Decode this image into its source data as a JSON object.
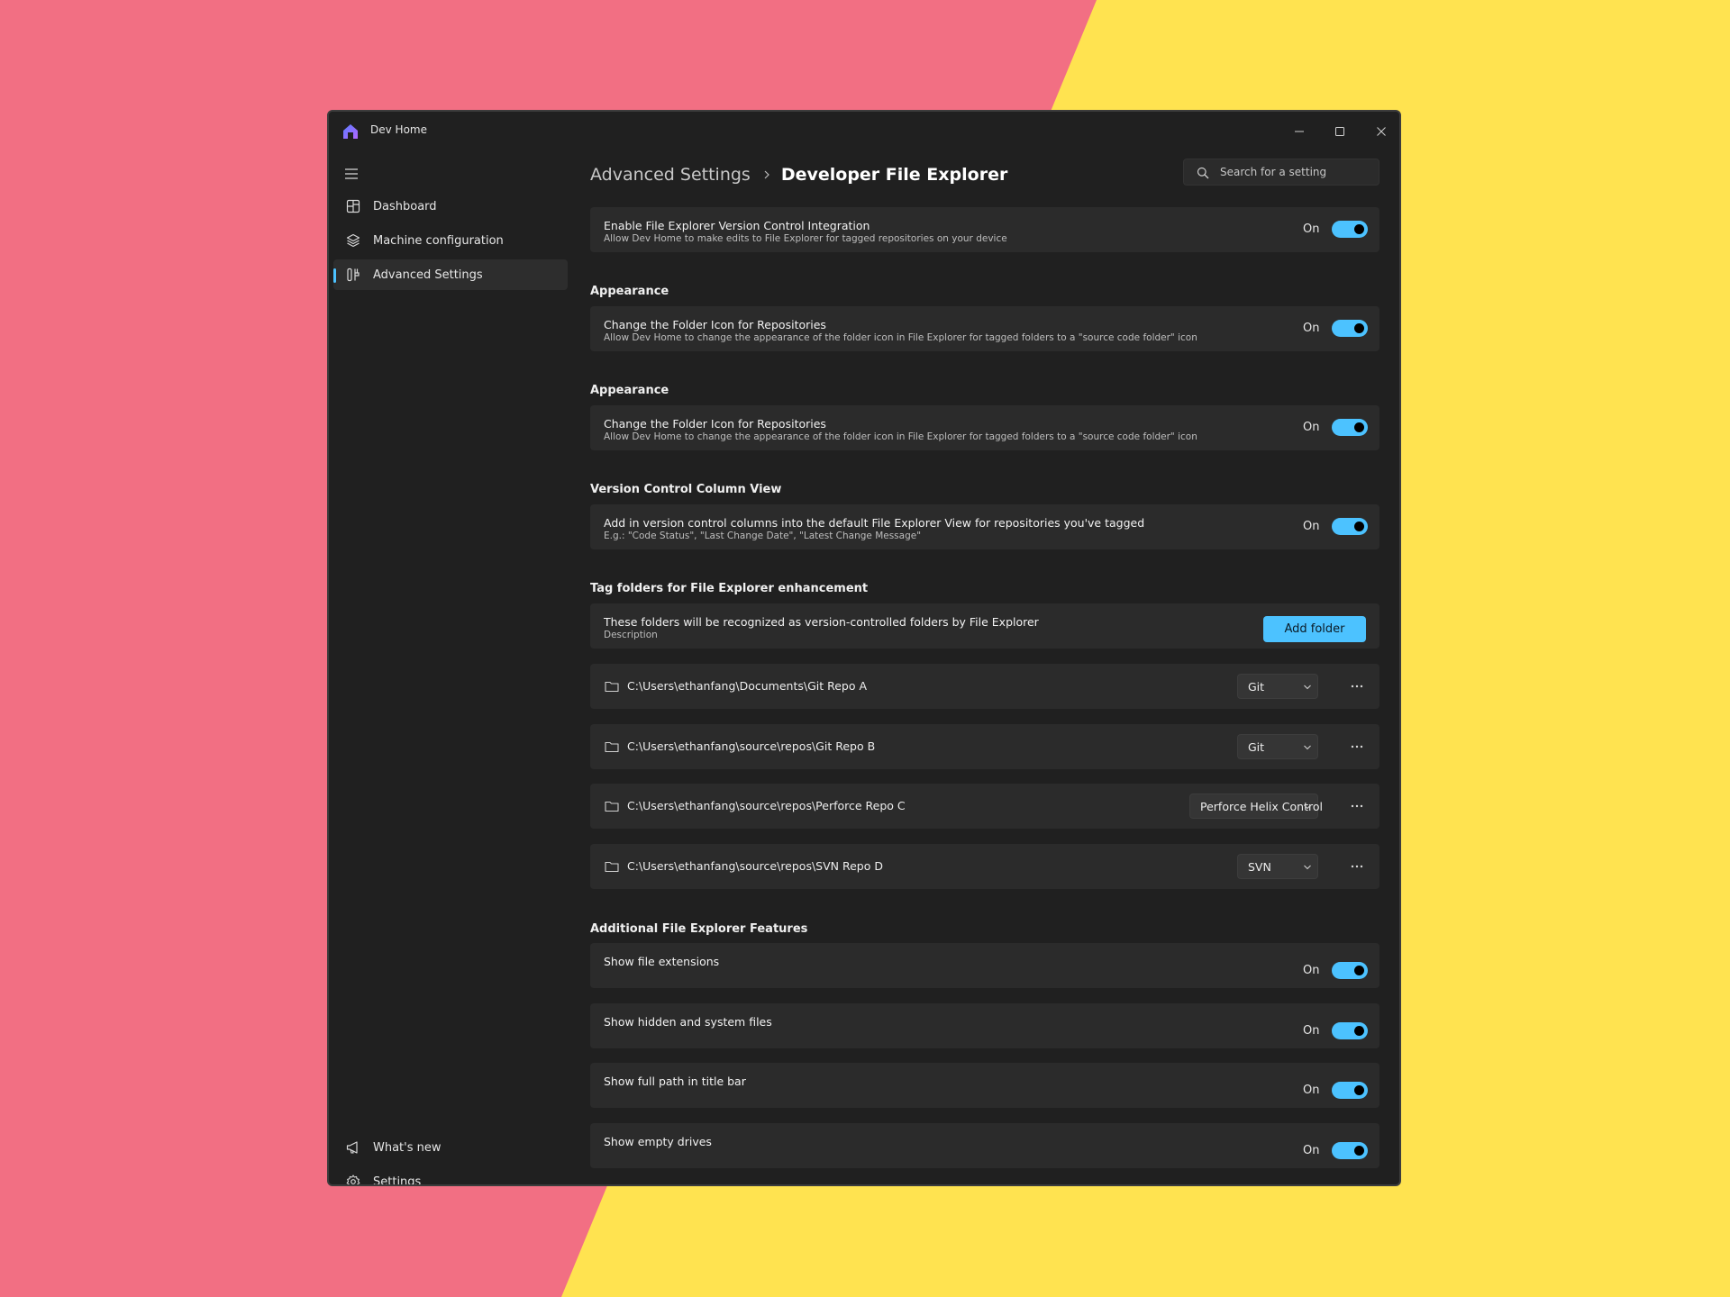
{
  "app": {
    "title": "Dev Home"
  },
  "colors": {
    "accent": "#4cc2ff",
    "background_pink": "#f26f83",
    "background_yellow": "#ffe350",
    "window_bg": "#202020",
    "card_bg": "#2b2b2b"
  },
  "nav": {
    "items": [
      {
        "label": "Dashboard",
        "icon": "dashboard-icon"
      },
      {
        "label": "Machine configuration",
        "icon": "layers-icon"
      },
      {
        "label": "Advanced Settings",
        "icon": "advanced-settings-icon",
        "active": true
      }
    ],
    "footer": [
      {
        "label": "What's new",
        "icon": "megaphone-icon"
      },
      {
        "label": "Settings",
        "icon": "gear-icon"
      }
    ]
  },
  "breadcrumb": {
    "parent": "Advanced Settings",
    "current": "Developer File Explorer"
  },
  "search": {
    "placeholder": "Search for a setting"
  },
  "state_on": "On",
  "main": {
    "integration": {
      "title": "Enable File Explorer Version Control Integration",
      "description": "Allow Dev Home to make edits to File Explorer for tagged repositories on your device",
      "state": "On"
    },
    "appearance1": {
      "header": "Appearance",
      "title": "Change the Folder Icon for Repositories",
      "description": "Allow Dev Home to change the appearance of the folder icon in File Explorer for tagged folders to a \"source code folder\" icon",
      "state": "On"
    },
    "appearance2": {
      "header": "Appearance",
      "title": "Change the Folder Icon for Repositories",
      "description": "Allow Dev Home to change the appearance of the folder icon in File Explorer for tagged folders to a \"source code folder\" icon",
      "state": "On"
    },
    "column_view": {
      "header": "Version Control Column View",
      "title": "Add in version control columns into the default File Explorer View for repositories you've tagged",
      "description": "E.g.: \"Code Status\", \"Last Change Date\", \"Latest Change Message\"",
      "state": "On"
    },
    "tag_folders": {
      "header": "Tag folders for File Explorer enhancement",
      "title": "These folders will be recognized as version-controlled folders by File Explorer",
      "description": "Description",
      "add_button": "Add folder"
    },
    "repos": [
      {
        "path": "C:\\Users\\ethanfang\\Documents\\Git Repo A",
        "vcs": "Git"
      },
      {
        "path": "C:\\Users\\ethanfang\\source\\repos\\Git Repo B",
        "vcs": "Git"
      },
      {
        "path": "C:\\Users\\ethanfang\\source\\repos\\Perforce Repo C",
        "vcs": "Perforce Helix Control"
      },
      {
        "path": "C:\\Users\\ethanfang\\source\\repos\\SVN Repo D",
        "vcs": "SVN"
      }
    ],
    "additional": {
      "header": "Additional File Explorer Features",
      "items": [
        {
          "title": "Show file extensions",
          "state": "On"
        },
        {
          "title": "Show hidden and system files",
          "state": "On"
        },
        {
          "title": "Show full path in title bar",
          "state": "On"
        },
        {
          "title": "Show empty drives",
          "state": "On"
        }
      ]
    }
  }
}
